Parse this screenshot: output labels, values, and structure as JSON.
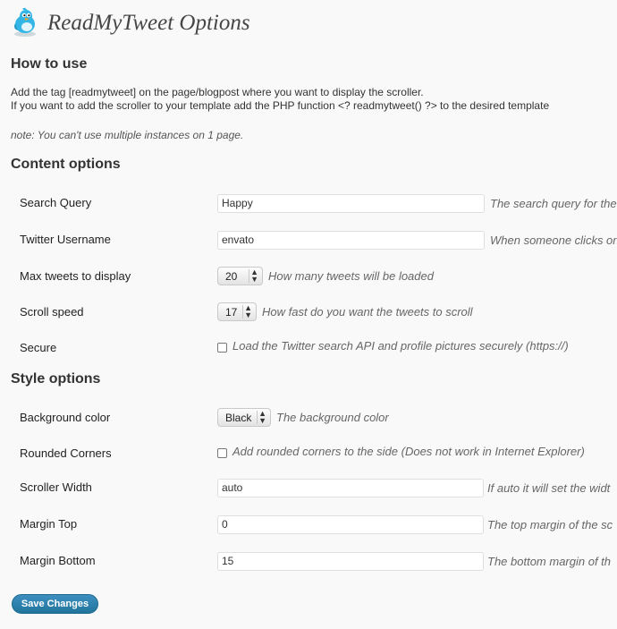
{
  "header": {
    "title": "ReadMyTweet Options"
  },
  "how_to_use": {
    "heading": "How to use",
    "line1": "Add the tag [readmytweet] on the page/blogpost where you want to display the scroller.",
    "line2": "If you want to add the scroller to your template add the PHP function <? readmytweet() ?> to the desired template",
    "note": "note: You can't use multiple instances on 1 page."
  },
  "content_options": {
    "heading": "Content options",
    "search_query": {
      "label": "Search Query",
      "value": "Happy",
      "desc": "The search query for the"
    },
    "twitter_username": {
      "label": "Twitter Username",
      "value": "envato",
      "desc": "When someone clicks on"
    },
    "max_tweets": {
      "label": "Max tweets to display",
      "value": "20",
      "desc": "How many tweets will be loaded"
    },
    "scroll_speed": {
      "label": "Scroll speed",
      "value": "17",
      "desc": "How fast do you want the tweets to scroll"
    },
    "secure": {
      "label": "Secure",
      "checked": false,
      "desc": "Load the Twitter search API and profile pictures securely (https://)"
    }
  },
  "style_options": {
    "heading": "Style options",
    "background_color": {
      "label": "Background color",
      "value": "Black",
      "desc": "The background color"
    },
    "rounded_corners": {
      "label": "Rounded Corners",
      "checked": false,
      "desc": "Add rounded corners to the side (Does not work in Internet Explorer)"
    },
    "scroller_width": {
      "label": "Scroller Width",
      "value": "auto",
      "desc": "If auto it will set the widt"
    },
    "margin_top": {
      "label": "Margin Top",
      "value": "0",
      "desc": "The top margin of the sc"
    },
    "margin_bottom": {
      "label": "Margin Bottom",
      "value": "15",
      "desc": "The bottom margin of th"
    }
  },
  "save_button": {
    "label": "Save Changes"
  }
}
